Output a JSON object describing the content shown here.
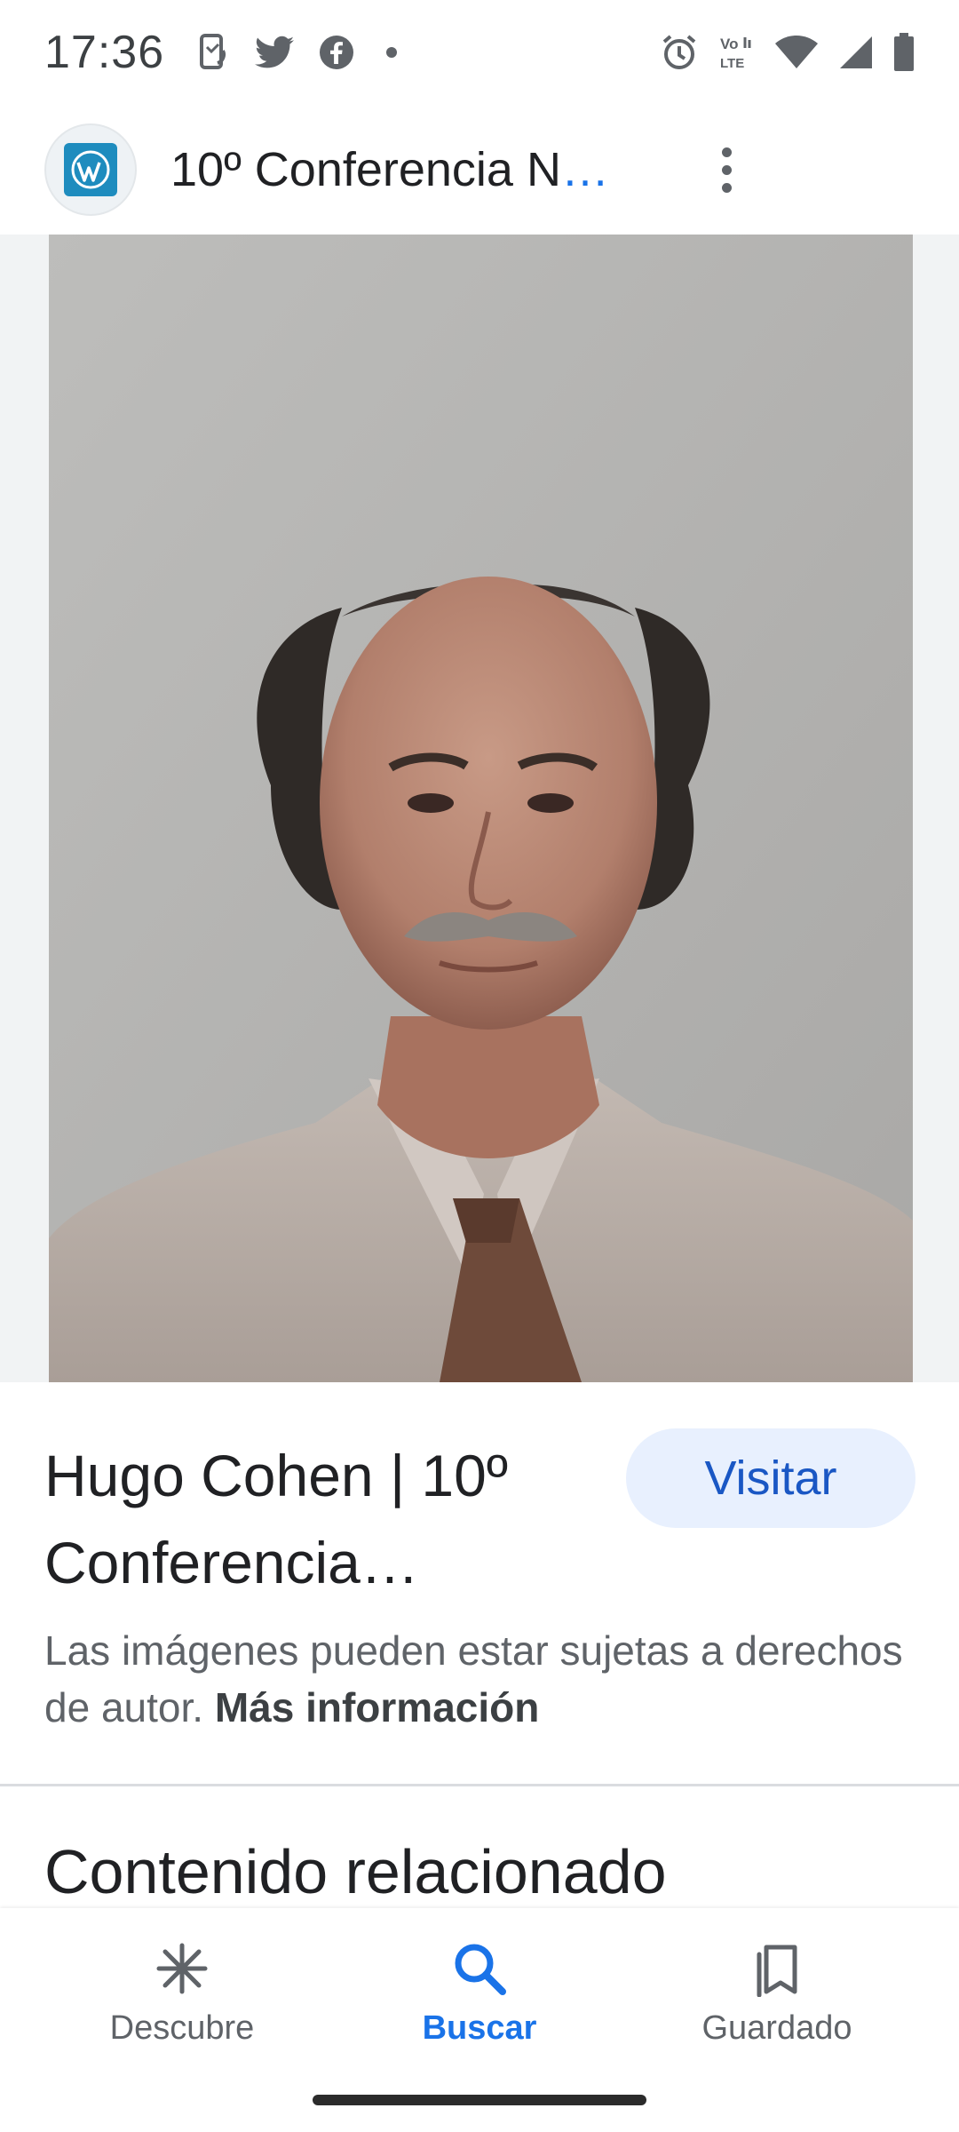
{
  "status_bar": {
    "time": "17:36",
    "icons": [
      "screen-rotate-icon",
      "twitter-icon",
      "facebook-icon",
      "notification-dot",
      "alarm-icon",
      "volte-icon",
      "wifi-icon",
      "signal-icon",
      "battery-icon"
    ]
  },
  "header": {
    "site_icon": "wordpress-icon",
    "title": "10º Conferencia N",
    "ellipsis": "…"
  },
  "image": {
    "subject": "portrait-photo"
  },
  "result": {
    "title": "Hugo Cohen | 10º Conferencia…",
    "visit_label": "Visitar",
    "copyright_text": "Las imágenes pueden estar sujetas a derechos de autor.",
    "more_info_label": "Más información"
  },
  "related": {
    "heading": "Contenido relacionado"
  },
  "bottom_nav": {
    "items": [
      {
        "label": "Descubre",
        "icon": "asterisk-icon",
        "active": false
      },
      {
        "label": "Buscar",
        "icon": "search-icon",
        "active": true
      },
      {
        "label": "Guardado",
        "icon": "bookmarks-icon",
        "active": false
      }
    ]
  },
  "colors": {
    "accent": "#1a73e8",
    "visit_bg": "#e8f0fe",
    "wordpress": "#1e8cbe"
  }
}
